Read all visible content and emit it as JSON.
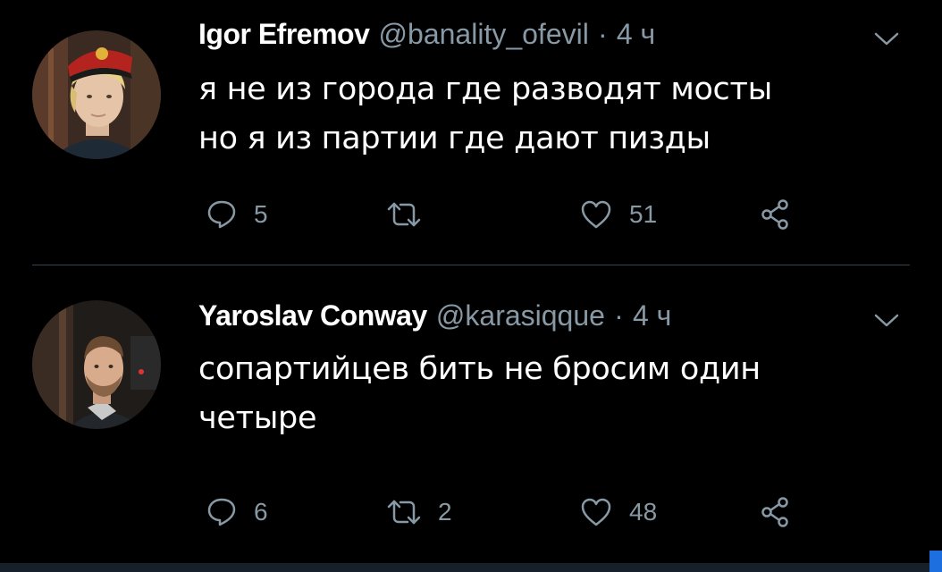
{
  "tweets": [
    {
      "author_name": "Igor Efremov",
      "handle": "@banality_ofevil",
      "separator": "·",
      "time": "4 ч",
      "text_lines": [
        "я не из города где разводят мосты",
        "но я из партии где дают пизды"
      ],
      "reply_count": "5",
      "retweet_count": "",
      "like_count": "51"
    },
    {
      "author_name": "Yaroslav Conway",
      "handle": "@karasiqque",
      "separator": "·",
      "time": "4 ч",
      "text_lines": [
        "сопартийцев бить не бросим один",
        "четыре"
      ],
      "reply_count": "6",
      "retweet_count": "2",
      "like_count": "48"
    }
  ],
  "icons": {
    "reply": "speech-bubble-icon",
    "retweet": "retweet-arrows-icon",
    "like": "heart-icon",
    "share": "share-nodes-icon",
    "menu": "chevron-down-icon"
  },
  "colors": {
    "background": "#000000",
    "text_primary": "#ffffff",
    "text_secondary": "#8899a6",
    "divider": "#38444d"
  }
}
